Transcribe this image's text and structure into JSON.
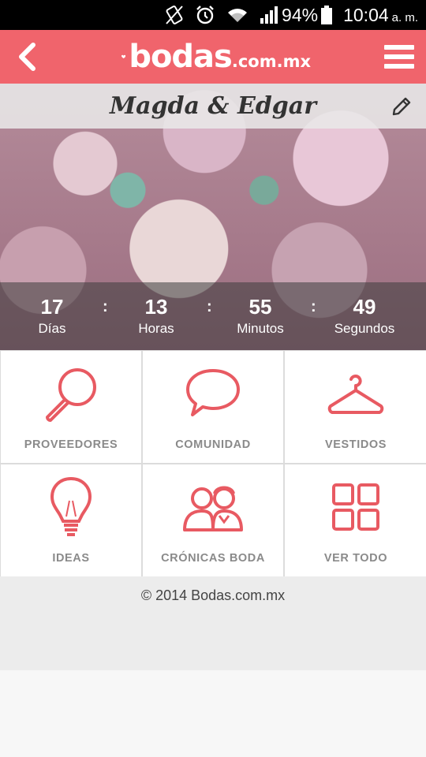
{
  "status_bar": {
    "battery_percent": "94%",
    "time": "10:04",
    "ampm": "a. m.",
    "icons": [
      "vibrate-icon",
      "alarm-icon",
      "wifi-icon",
      "signal-icon",
      "battery-icon"
    ]
  },
  "header": {
    "logo_word": "bodas",
    "logo_suffix": ".com.mx",
    "brand_color": "#f0646c"
  },
  "hero": {
    "couple_name": "Magda & Edgar"
  },
  "countdown": [
    {
      "value": "17",
      "label": "Días"
    },
    {
      "value": "13",
      "label": "Horas"
    },
    {
      "value": "55",
      "label": "Minutos"
    },
    {
      "value": "49",
      "label": "Segundos"
    }
  ],
  "countdown_separator": ":",
  "menu": [
    {
      "label": "PROVEEDORES",
      "icon": "magnifier-icon"
    },
    {
      "label": "COMUNIDAD",
      "icon": "speech-bubble-icon"
    },
    {
      "label": "VESTIDOS",
      "icon": "hanger-icon"
    },
    {
      "label": "IDEAS",
      "icon": "lightbulb-icon"
    },
    {
      "label": "CRÓNICAS BODA",
      "icon": "couple-icon"
    },
    {
      "label": "VER TODO",
      "icon": "grid-icon"
    }
  ],
  "footer": {
    "copyright": "© 2014 Bodas.com.mx"
  }
}
